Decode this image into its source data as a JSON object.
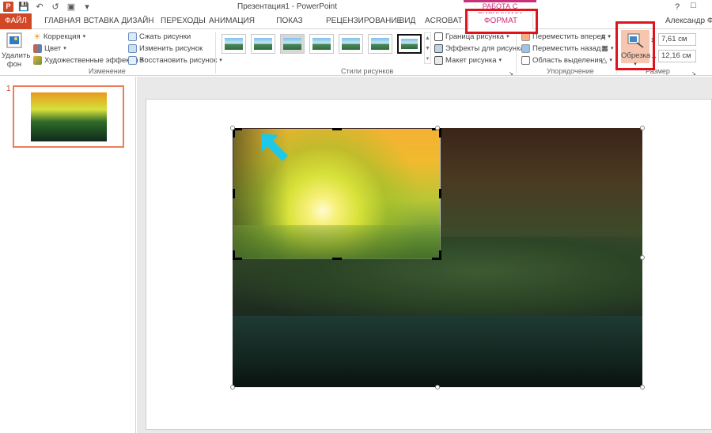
{
  "app": {
    "window_title": "Презентация1 - PowerPoint",
    "contextual_tab_title": "РАБОТА С РИСУНКАМИ",
    "user_name": "Александр Фрол",
    "help": "?",
    "logo": "P"
  },
  "qat": {
    "icons": [
      "save-icon",
      "undo-icon",
      "redo-icon",
      "start-slideshow-icon"
    ]
  },
  "tabs": {
    "file": "ФАЙЛ",
    "home": "ГЛАВНАЯ",
    "insert": "ВСТАВКА",
    "design": "ДИЗАЙН",
    "transitions": "ПЕРЕХОДЫ",
    "animations": "АНИМАЦИЯ",
    "slideshow": "ПОКАЗ СЛАЙДОВ",
    "review": "РЕЦЕНЗИРОВАНИЕ",
    "view": "ВИД",
    "acrobat": "ACROBAT",
    "format": "ФОРМАТ"
  },
  "ribbon": {
    "adjust": {
      "remove_bg": "Удалить фон",
      "remove_bg_l1": "Удалить",
      "remove_bg_l2": "фон",
      "corrections": "Коррекция",
      "color": "Цвет",
      "artistic": "Художественные эффекты",
      "compress": "Сжать рисунки",
      "change": "Изменить рисунок",
      "reset": "Восстановить рисунок",
      "group_label": "Изменение"
    },
    "styles": {
      "border": "Граница рисунка",
      "effects": "Эффекты для рисунка",
      "layout": "Макет рисунка",
      "group_label": "Стили рисунков"
    },
    "arrange": {
      "bring_forward": "Переместить вперед",
      "send_backward": "Переместить назад",
      "selection_pane": "Область выделения",
      "group_label": "Упорядочение"
    },
    "size": {
      "crop": "Обрезка",
      "height": "7,61 см",
      "width": "12,16 см",
      "group_label": "Размер"
    }
  },
  "slides": {
    "number": "1"
  },
  "colors": {
    "accent_file": "#d24726",
    "accent_contextual": "#c9307a",
    "highlight_box": "#e0121b",
    "arrow": "#1ec8e6"
  }
}
